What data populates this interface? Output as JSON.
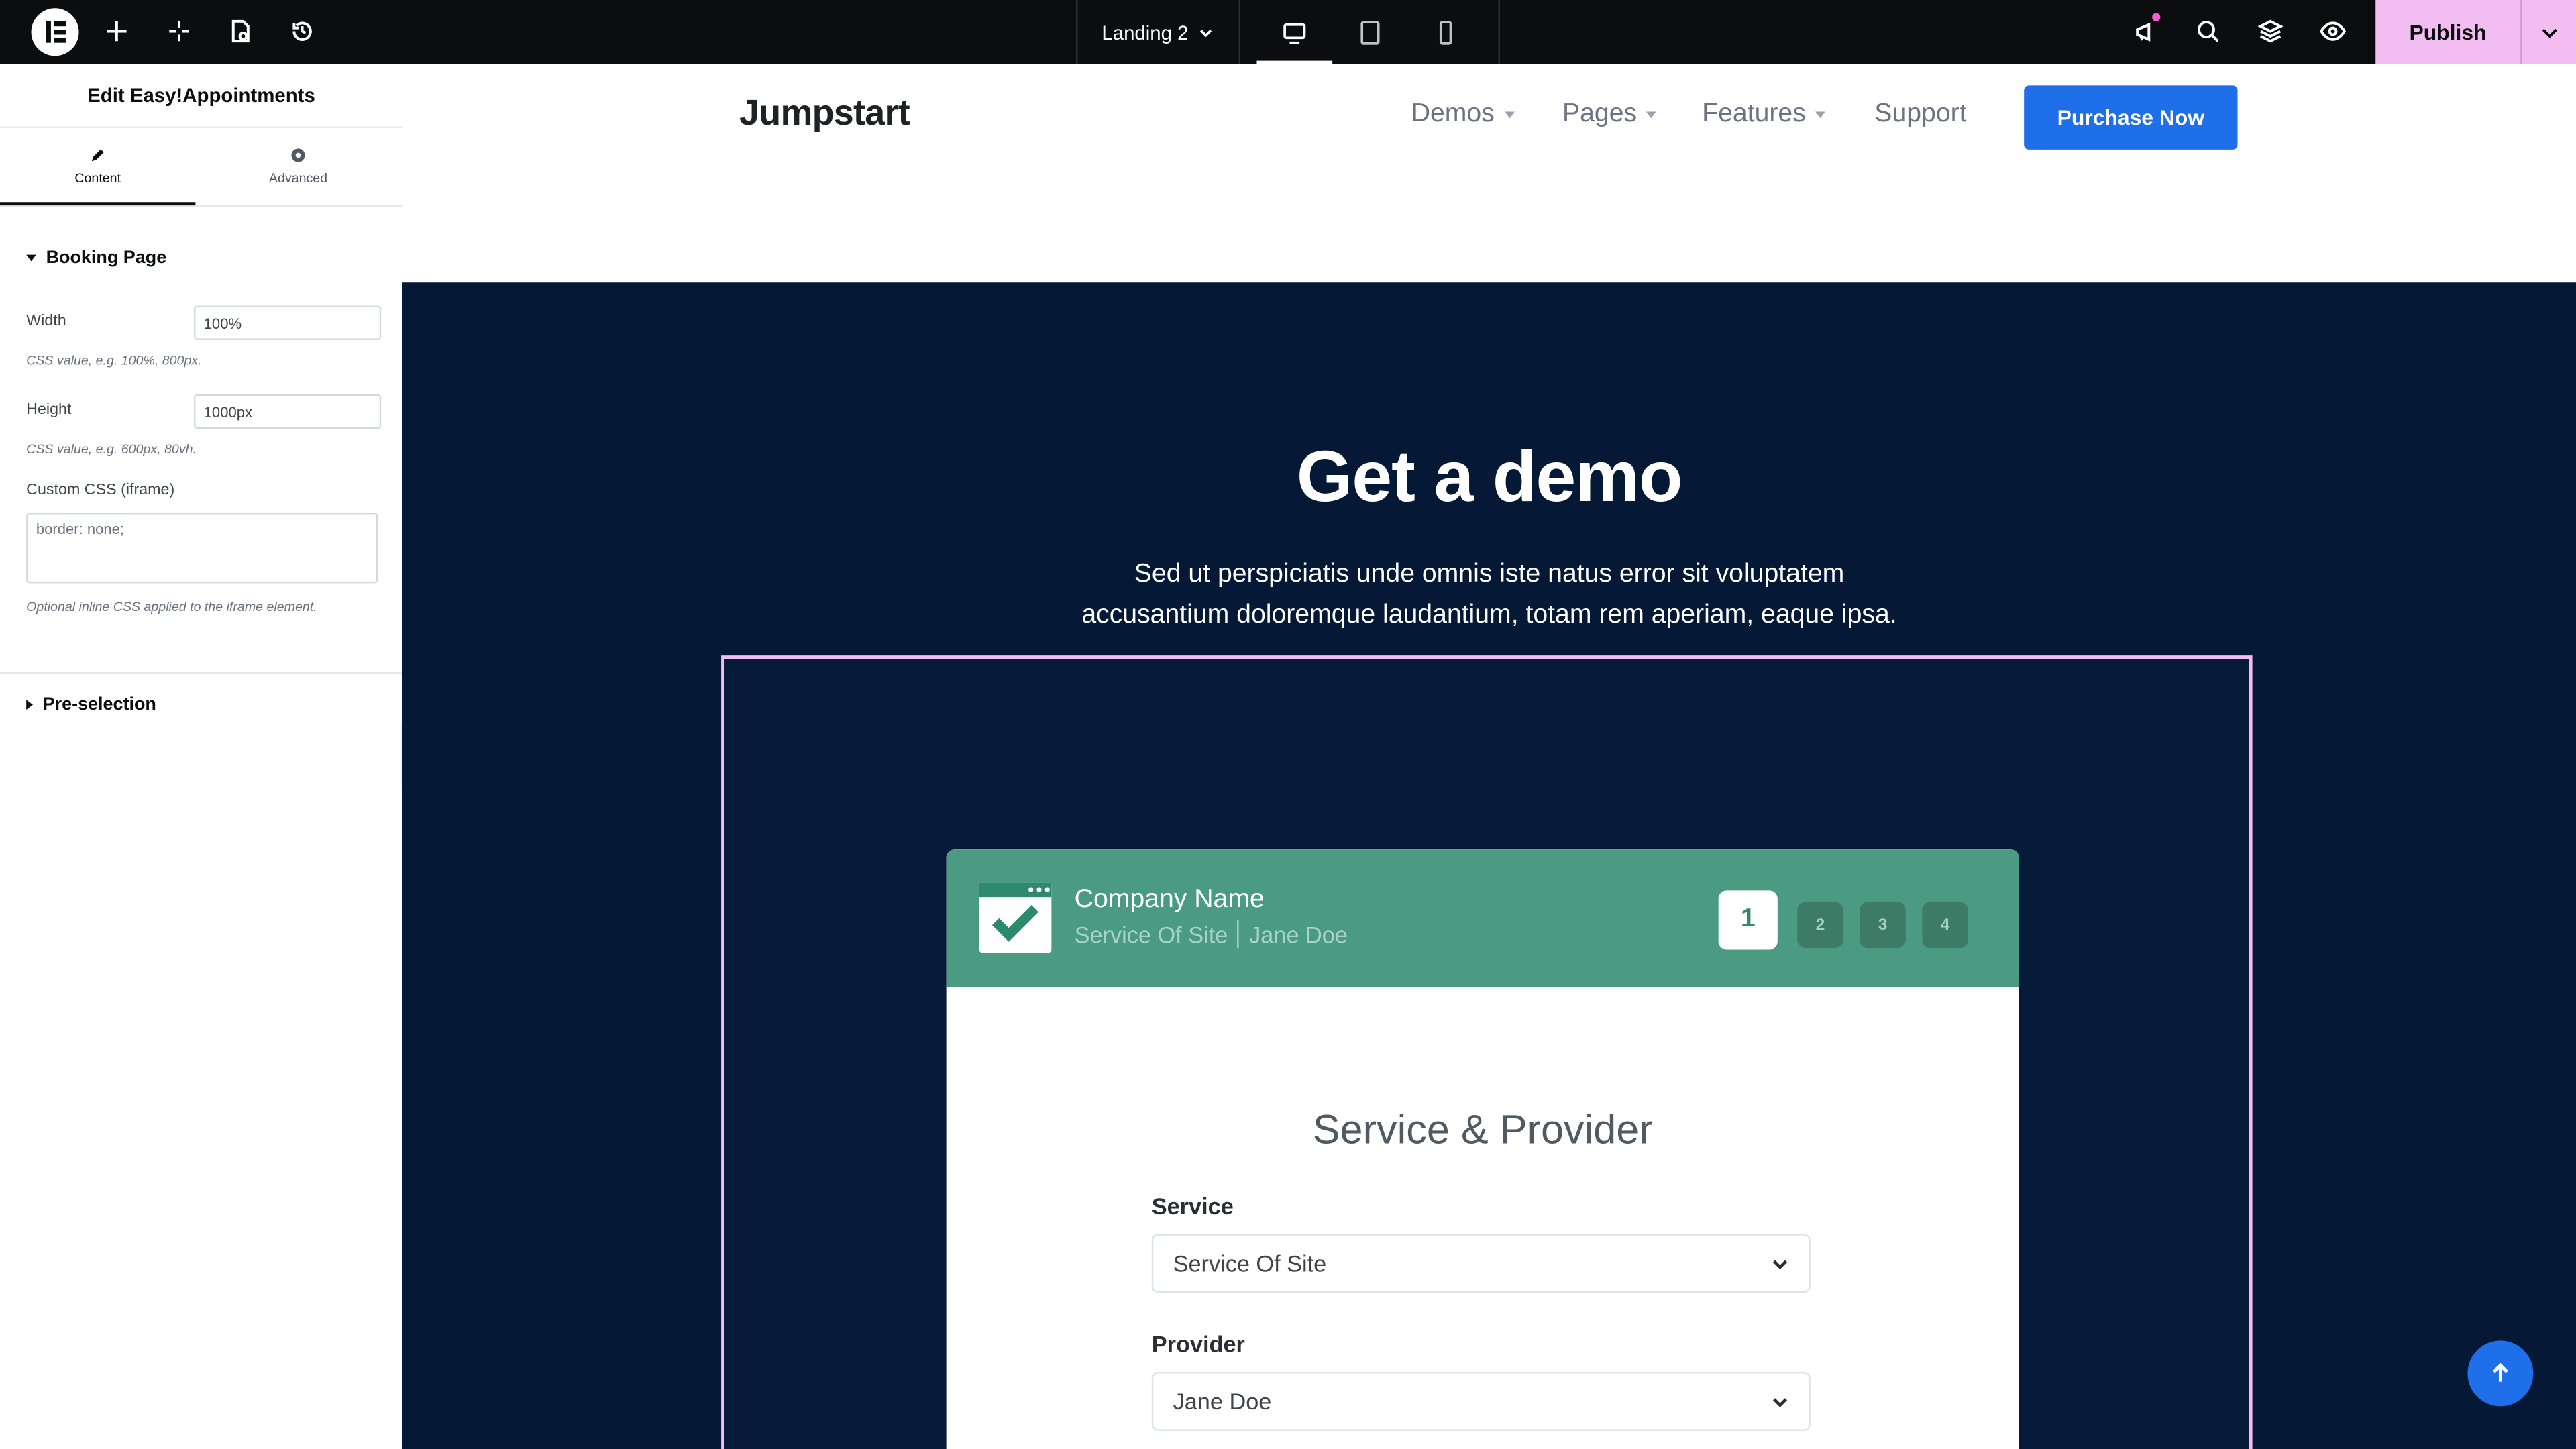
{
  "topbar": {
    "page_name": "Landing 2",
    "publish_label": "Publish"
  },
  "panel": {
    "title": "Edit Easy!Appointments",
    "tabs": [
      {
        "label": "Content",
        "icon": "pencil-icon"
      },
      {
        "label": "Advanced",
        "icon": "gear-icon"
      }
    ],
    "booking_section": "Booking Page",
    "width_label": "Width",
    "width_value": "100%",
    "width_hint": "CSS value, e.g. 100%, 800px.",
    "height_label": "Height",
    "height_value": "1000px",
    "height_hint": "CSS value, e.g. 600px, 80vh.",
    "css_label": "Custom CSS (iframe)",
    "css_value": "border: none;",
    "css_hint": "Optional inline CSS applied to the iframe element.",
    "preselection_section": "Pre-selection"
  },
  "site": {
    "brand": "Jumpstart",
    "nav": [
      "Demos",
      "Pages",
      "Features",
      "Support"
    ],
    "cta": "Purchase Now",
    "hero_title": "Get a demo",
    "hero_sub_1": "Sed ut perspiciatis unde omnis iste natus error sit voluptatem",
    "hero_sub_2": "accusantium doloremque laudantium, totam rem aperiam, eaque ipsa."
  },
  "booking": {
    "company": "Company Name",
    "service_meta": "Service Of Site",
    "provider_meta": "Jane Doe",
    "steps": [
      "1",
      "2",
      "3",
      "4"
    ],
    "title": "Service & Provider",
    "service_label": "Service",
    "service_value": "Service Of Site",
    "provider_label": "Provider",
    "provider_value": "Jane Doe"
  },
  "colors": {
    "accent": "#1f6fea",
    "hero_bg": "#051937",
    "booking_header": "#4a9b82",
    "publish_bg": "#f2bdf0"
  }
}
